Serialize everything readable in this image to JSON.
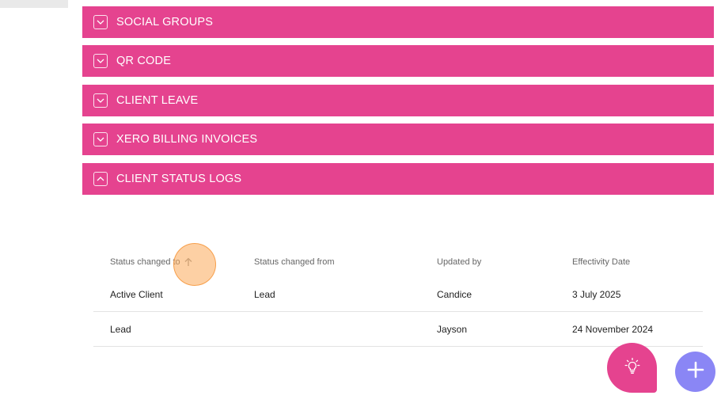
{
  "sections": [
    {
      "title": "SOCIAL GROUPS",
      "expanded": false
    },
    {
      "title": "QR CODE",
      "expanded": false
    },
    {
      "title": "CLIENT LEAVE",
      "expanded": false
    },
    {
      "title": "XERO BILLING INVOICES",
      "expanded": false
    },
    {
      "title": "CLIENT STATUS LOGS",
      "expanded": true
    }
  ],
  "status_logs": {
    "columns": [
      "Status changed to",
      "Status changed from",
      "Updated by",
      "Effectivity Date"
    ],
    "sort_column": "Status changed to",
    "sort_direction": "ascending",
    "rows": [
      {
        "to": "Active Client",
        "from": "Lead",
        "updated_by": "Candice",
        "date": "3 July 2025"
      },
      {
        "to": "Lead",
        "from": "",
        "updated_by": "Jayson",
        "date": "24 November 2024"
      }
    ]
  },
  "icons": {
    "collapsed": "chevron-down-icon",
    "expanded": "chevron-up-icon",
    "sort": "arrow-up-icon",
    "help": "lightbulb-icon",
    "add": "plus-icon"
  },
  "colors": {
    "accent": "#e5438f",
    "fab_add": "#8a86f5",
    "click_marker": "#fbaa5a"
  }
}
